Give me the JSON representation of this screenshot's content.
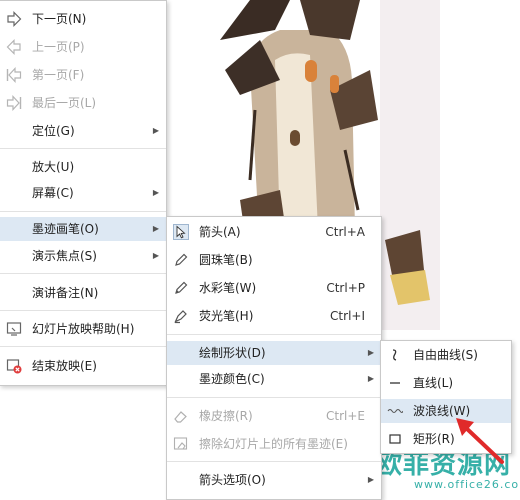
{
  "main_menu": {
    "items": [
      {
        "label": "下一页(N)",
        "icon": "next-page-icon"
      },
      {
        "label": "上一页(P)",
        "icon": "prev-page-icon"
      },
      {
        "label": "第一页(F)",
        "icon": "first-page-icon"
      },
      {
        "label": "最后一页(L)",
        "icon": "last-page-icon"
      },
      {
        "label": "定位(G)"
      },
      {
        "label": "放大(U)"
      },
      {
        "label": "屏幕(C)"
      },
      {
        "label": "墨迹画笔(O)"
      },
      {
        "label": "演示焦点(S)"
      },
      {
        "label": "演讲备注(N)"
      },
      {
        "label": "幻灯片放映帮助(H)",
        "icon": "help-icon"
      },
      {
        "label": "结束放映(E)",
        "icon": "end-show-icon"
      }
    ]
  },
  "sub_menu": {
    "items": [
      {
        "label": "箭头(A)",
        "accel": "Ctrl+A",
        "icon": "cursor-arrow-icon"
      },
      {
        "label": "圆珠笔(B)",
        "icon": "ballpoint-pen-icon"
      },
      {
        "label": "水彩笔(W)",
        "accel": "Ctrl+P",
        "icon": "watercolor-pen-icon"
      },
      {
        "label": "荧光笔(H)",
        "accel": "Ctrl+I",
        "icon": "highlighter-icon"
      },
      {
        "label": "绘制形状(D)"
      },
      {
        "label": "墨迹颜色(C)"
      },
      {
        "label": "橡皮擦(R)",
        "accel": "Ctrl+E",
        "icon": "eraser-icon"
      },
      {
        "label": "擦除幻灯片上的所有墨迹(E)",
        "icon": "erase-all-icon"
      },
      {
        "label": "箭头选项(O)"
      }
    ]
  },
  "shape_menu": {
    "items": [
      {
        "label": "自由曲线(S)",
        "icon": "freeform-curve-icon"
      },
      {
        "label": "直线(L)",
        "icon": "straight-line-icon"
      },
      {
        "label": "波浪线(W)",
        "icon": "wavy-line-icon"
      },
      {
        "label": "矩形(R)",
        "icon": "rectangle-icon"
      }
    ]
  },
  "watermark": {
    "title": "欧菲资源网",
    "url": "www.office26.com"
  },
  "colors": {
    "highlight": "#dde8f3",
    "accent_red": "#e02a2a",
    "watermark": "#36b0a8"
  }
}
